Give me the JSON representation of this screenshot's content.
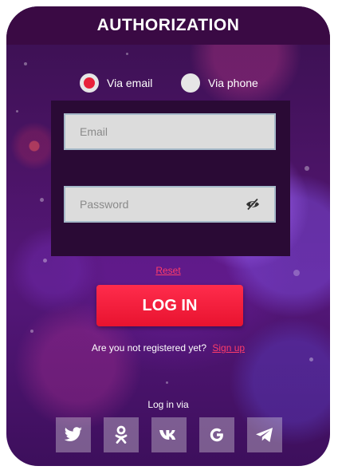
{
  "header": {
    "title": "AUTHORIZATION"
  },
  "login_method": {
    "options": [
      {
        "label": "Via email",
        "selected": true
      },
      {
        "label": "Via phone",
        "selected": false
      }
    ]
  },
  "form": {
    "email_placeholder": "Email",
    "email_value": "",
    "password_placeholder": "Password",
    "password_value": ""
  },
  "reset_link": "Reset",
  "login_button": "LOG IN",
  "register": {
    "prompt": "Are you not registered yet?",
    "signup_link": "Sign up"
  },
  "social": {
    "label": "Log in via",
    "networks": [
      {
        "icon": "twitter-icon"
      },
      {
        "icon": "odnoklassniki-icon"
      },
      {
        "icon": "vk-icon"
      },
      {
        "icon": "google-icon"
      },
      {
        "icon": "telegram-icon"
      }
    ]
  },
  "colors": {
    "accent": "#e8213a",
    "link": "#ff3c6a",
    "header_bg": "#3a0a44",
    "form_bg": "#2a0a35"
  }
}
